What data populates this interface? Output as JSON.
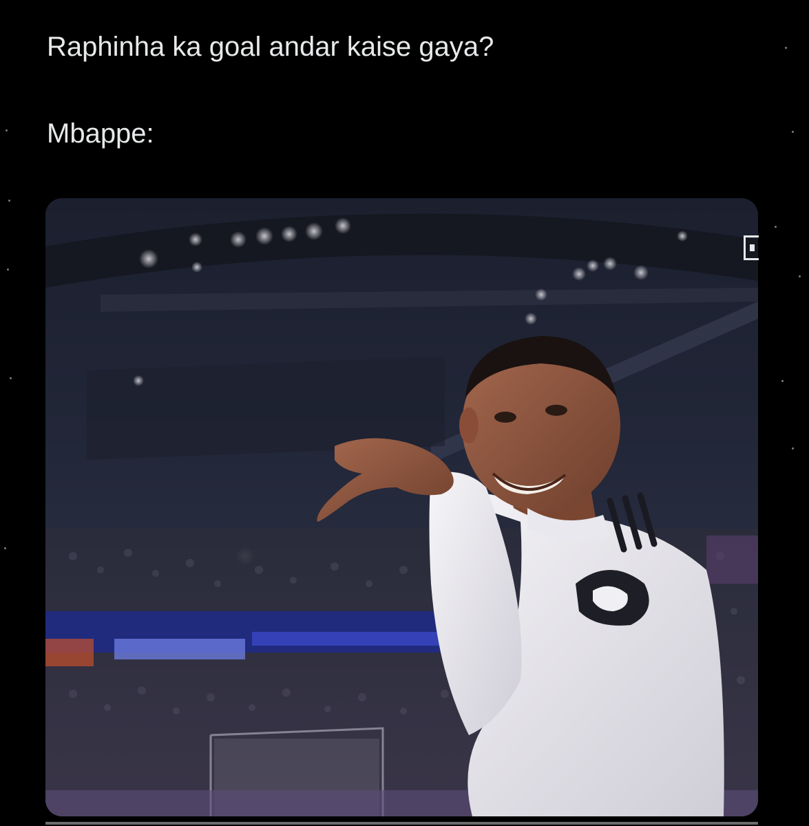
{
  "post": {
    "line1": "Raphinha ka goal andar kaise gaya?",
    "line2": "Mbappe:"
  },
  "media": {
    "kind": "video-still",
    "subject": "player celebrating with hand gesture in stadium"
  },
  "colors": {
    "background": "#000000",
    "text": "#e7e9ea",
    "jersey": "#f2f1f4"
  }
}
